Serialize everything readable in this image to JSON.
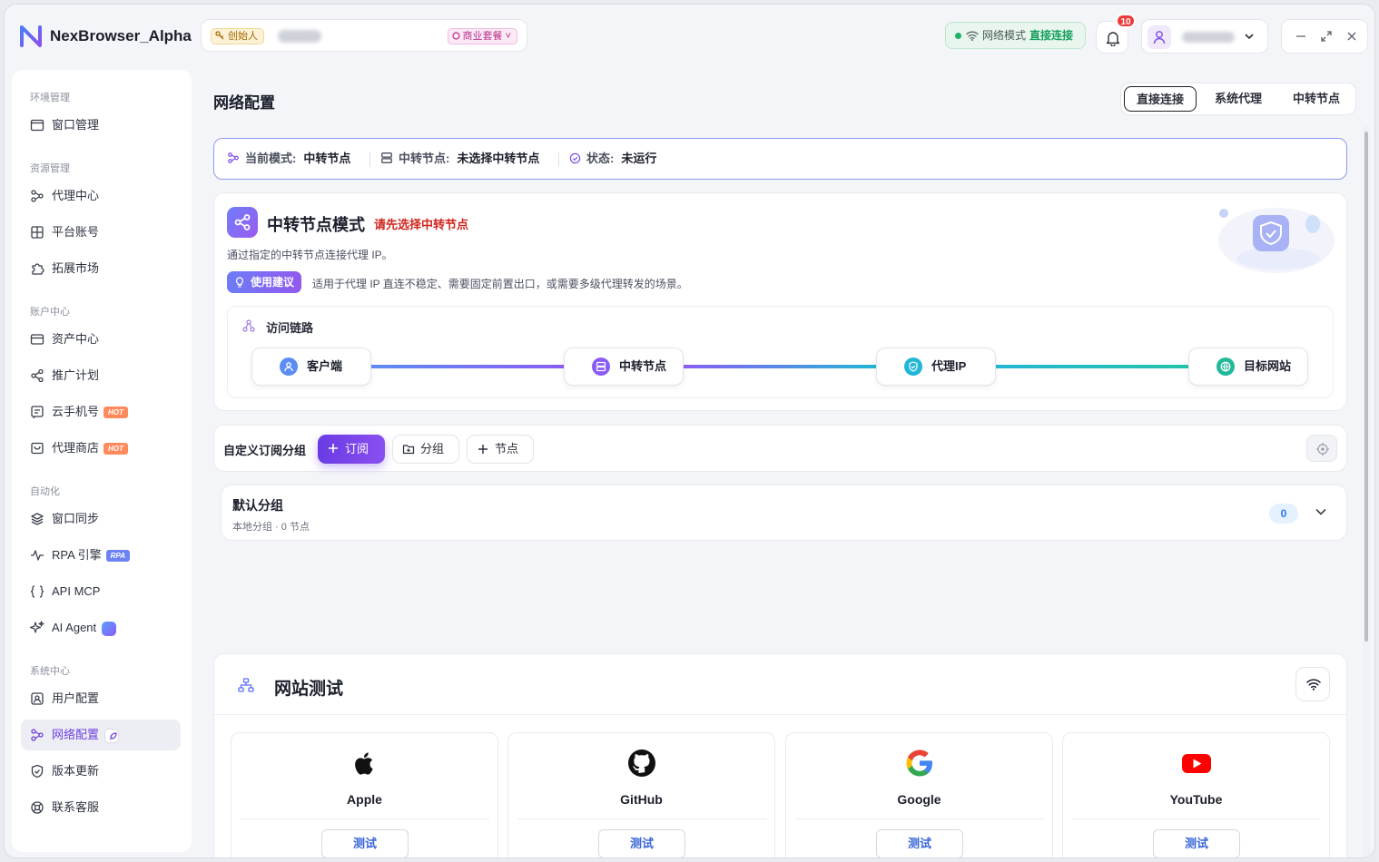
{
  "app": {
    "name": "NexBrowser_Alpha"
  },
  "user": {
    "role_badge": "创始人",
    "plan_badge": "商业套餐"
  },
  "network_indicator": {
    "label": "网络模式",
    "value": "直接连接"
  },
  "notifications": {
    "count": "10"
  },
  "sidebar": {
    "sections": [
      {
        "title": "环境管理",
        "items": [
          {
            "label": "窗口管理",
            "icon": "window-icon"
          }
        ]
      },
      {
        "title": "资源管理",
        "items": [
          {
            "label": "代理中心",
            "icon": "proxy-icon"
          },
          {
            "label": "平台账号",
            "icon": "grid-icon"
          },
          {
            "label": "拓展市场",
            "icon": "puzzle-icon"
          }
        ]
      },
      {
        "title": "账户中心",
        "items": [
          {
            "label": "资产中心",
            "icon": "wallet-icon"
          },
          {
            "label": "推广计划",
            "icon": "share-icon"
          },
          {
            "label": "云手机号",
            "icon": "phone-icon",
            "tag": "HOT"
          },
          {
            "label": "代理商店",
            "icon": "shop-icon",
            "tag": "HOT"
          }
        ]
      },
      {
        "title": "自动化",
        "items": [
          {
            "label": "窗口同步",
            "icon": "layers-icon"
          },
          {
            "label": "RPA 引擎",
            "icon": "pulse-icon",
            "tag": "RPA"
          },
          {
            "label": "API MCP",
            "icon": "braces-icon"
          },
          {
            "label": "AI Agent",
            "icon": "sparkle-icon"
          }
        ]
      },
      {
        "title": "系统中心",
        "items": [
          {
            "label": "用户配置",
            "icon": "user-config-icon"
          },
          {
            "label": "网络配置",
            "icon": "network-icon",
            "active": true
          },
          {
            "label": "版本更新",
            "icon": "shield-icon"
          },
          {
            "label": "联系客服",
            "icon": "support-icon"
          }
        ]
      }
    ]
  },
  "page": {
    "title": "网络配置",
    "mode_tabs": [
      "直接连接",
      "系统代理",
      "中转节点"
    ],
    "active_tab": "直接连接"
  },
  "status_bar": {
    "mode_label": "当前模式:",
    "mode_value": "中转节点",
    "node_label": "中转节点:",
    "node_value": "未选择中转节点",
    "state_label": "状态:",
    "state_value": "未运行"
  },
  "mode_card": {
    "title": "中转节点模式",
    "warning": "请先选择中转节点",
    "description": "通过指定的中转节点连接代理 IP。",
    "tip_label": "使用建议",
    "tip_text": "适用于代理 IP 直连不稳定、需要固定前置出口，或需要多级代理转发的场景。",
    "chain_title": "访问链路",
    "chain_nodes": [
      "客户端",
      "中转节点",
      "代理IP",
      "目标网站"
    ]
  },
  "subscription": {
    "title": "自定义订阅分组",
    "subscribe_btn": "订阅",
    "group_btn": "分组",
    "node_btn": "节点"
  },
  "group": {
    "name": "默认分组",
    "meta": "本地分组 · 0 节点",
    "count": "0"
  },
  "site_test": {
    "title": "网站测试",
    "sites": [
      {
        "name": "Apple",
        "button": "测试",
        "icon": "apple-icon"
      },
      {
        "name": "GitHub",
        "button": "测试",
        "icon": "github-icon"
      },
      {
        "name": "Google",
        "button": "测试",
        "icon": "google-icon"
      },
      {
        "name": "YouTube",
        "button": "测试",
        "icon": "youtube-icon"
      }
    ]
  },
  "colors": {
    "accent": "#6d3fe0",
    "primary_gradient": [
      "#6a3be4",
      "#8a4ff0"
    ],
    "success": "#13a05c",
    "danger": "#d0261e",
    "status_border": "#8a9bf0"
  }
}
